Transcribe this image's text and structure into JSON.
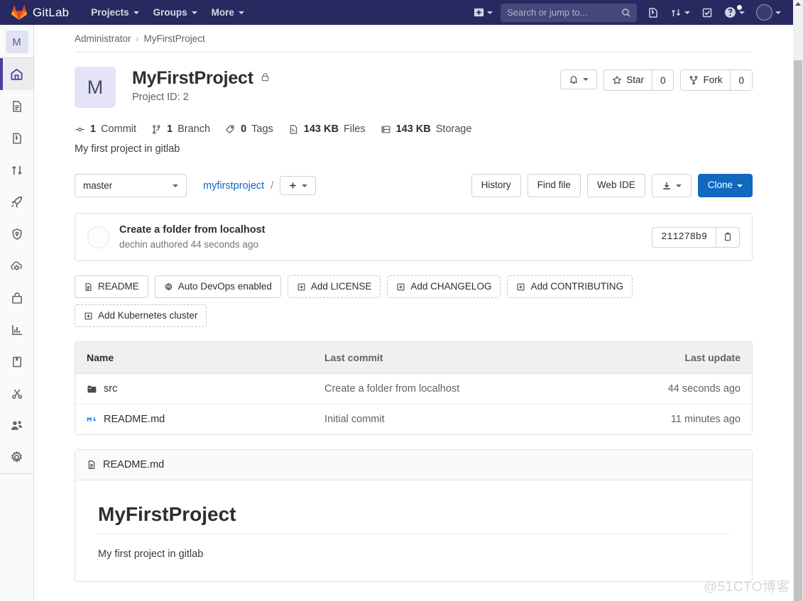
{
  "topnav": {
    "brand": "GitLab",
    "links": [
      {
        "label": "Projects",
        "name": "projects"
      },
      {
        "label": "Groups",
        "name": "groups"
      },
      {
        "label": "More",
        "name": "more"
      }
    ],
    "search_placeholder": "Search or jump to...",
    "search_value": "",
    "icons": {
      "plus": "plus-square-icon",
      "search": "search-icon",
      "issues": "issues-icon",
      "merge_requests": "merge-request-icon",
      "todos": "todo-check-icon",
      "help": "help-circle-icon",
      "avatar": "user-avatar"
    },
    "brand_bg": "#292961",
    "search_bg": "#46467a"
  },
  "sidebar": {
    "avatar_letter": "M",
    "items": [
      {
        "label": "Project overview",
        "icon": "home-icon",
        "active": true
      },
      {
        "label": "Repository",
        "icon": "document-icon",
        "active": false
      },
      {
        "label": "Issues",
        "icon": "issues-icon",
        "active": false
      },
      {
        "label": "Merge Requests",
        "icon": "merge-request-icon",
        "active": false
      },
      {
        "label": "CI / CD",
        "icon": "rocket-icon",
        "active": false
      },
      {
        "label": "Security & Compliance",
        "icon": "shield-icon",
        "active": false
      },
      {
        "label": "Operations",
        "icon": "cloud-gear-icon",
        "active": false
      },
      {
        "label": "Packages",
        "icon": "package-icon",
        "active": false
      },
      {
        "label": "Analytics",
        "icon": "chart-bar-icon",
        "active": false
      },
      {
        "label": "Wiki",
        "icon": "book-icon",
        "active": false
      },
      {
        "label": "Snippets",
        "icon": "scissors-icon",
        "active": false
      },
      {
        "label": "Members",
        "icon": "people-icon",
        "active": false
      },
      {
        "label": "Settings",
        "icon": "gear-icon",
        "active": false
      }
    ]
  },
  "breadcrumb": {
    "owner": "Administrator",
    "separator": "›",
    "project": "MyFirstProject"
  },
  "project": {
    "avatar_letter": "M",
    "title": "MyFirstProject",
    "visibility_icon": "lock-icon",
    "project_id_label": "Project ID: 2",
    "description": "My first project in gitlab",
    "stats": [
      {
        "icon": "commit-icon",
        "value": "1",
        "label": "Commit"
      },
      {
        "icon": "branch-icon",
        "value": "1",
        "label": "Branch"
      },
      {
        "icon": "tag-icon",
        "value": "0",
        "label": "Tags"
      },
      {
        "icon": "file-icon",
        "value": "143 KB",
        "label": "Files"
      },
      {
        "icon": "storage-icon",
        "value": "143 KB",
        "label": "Storage"
      }
    ],
    "notification_icon": "bell-icon",
    "star_label": "Star",
    "star_count": "0",
    "fork_label": "Fork",
    "fork_count": "0"
  },
  "repo_bar": {
    "branch": "master",
    "path_root": "myfirstproject",
    "path_sep": "/",
    "add_icon": "plus-icon",
    "history_label": "History",
    "find_file_label": "Find file",
    "web_ide_label": "Web IDE",
    "download_icon": "download-icon",
    "clone_label": "Clone",
    "clone_color": "#1068bf"
  },
  "last_commit": {
    "title": "Create a folder from localhost",
    "author": "dechin",
    "meta": "dechin authored 44 seconds ago",
    "sha": "211278b9",
    "copy_icon": "clipboard-icon"
  },
  "badges": [
    {
      "label": "README",
      "icon": "readme-icon",
      "dashed": false
    },
    {
      "label": "Auto DevOps enabled",
      "icon": "gear-icon",
      "dashed": false
    },
    {
      "label": "Add LICENSE",
      "icon": "plus-box-icon",
      "dashed": true
    },
    {
      "label": "Add CHANGELOG",
      "icon": "plus-box-icon",
      "dashed": true
    },
    {
      "label": "Add CONTRIBUTING",
      "icon": "plus-box-icon",
      "dashed": true
    },
    {
      "label": "Add Kubernetes cluster",
      "icon": "plus-box-icon",
      "dashed": true
    }
  ],
  "file_table": {
    "columns": {
      "name": "Name",
      "last_commit": "Last commit",
      "last_update": "Last update"
    },
    "rows": [
      {
        "name": "src",
        "icon": "folder-icon",
        "last_commit": "Create a folder from localhost",
        "last_update": "44 seconds ago"
      },
      {
        "name": "README.md",
        "icon": "markdown-icon",
        "last_commit": "Initial commit",
        "last_update": "11 minutes ago"
      }
    ]
  },
  "readme": {
    "filename": "README.md",
    "file_icon": "document-icon",
    "heading": "MyFirstProject",
    "paragraph": "My first project in gitlab"
  },
  "watermark": "@51CTO博客"
}
